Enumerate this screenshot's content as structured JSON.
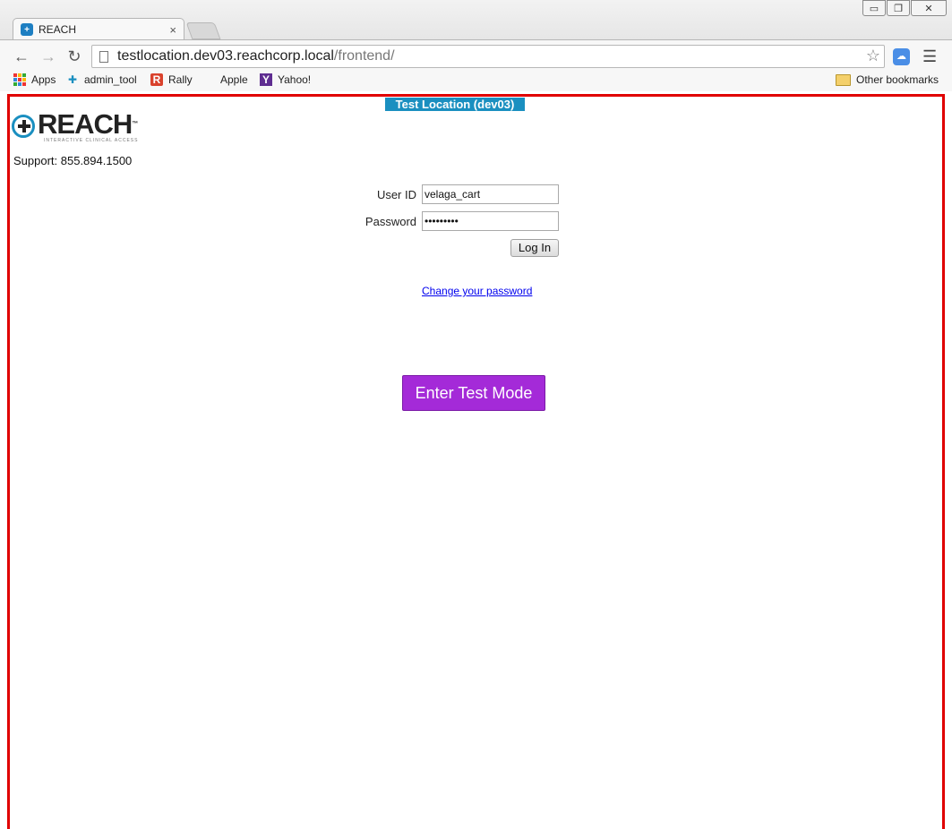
{
  "window": {
    "minimize_glyph": "▭",
    "restore_glyph": "❐",
    "close_glyph": "✕"
  },
  "tab": {
    "title": "REACH",
    "favicon": "+",
    "close_glyph": "×"
  },
  "toolbar": {
    "back_glyph": "←",
    "forward_glyph": "→",
    "reload_glyph": "↻",
    "url_host": "testlocation.dev03.reachcorp.local",
    "url_path": "/frontend/",
    "star_glyph": "☆",
    "menu_glyph": "☰",
    "extension_glyph": "☁"
  },
  "bookmarks": {
    "items": [
      {
        "label": "Apps",
        "icon": "apps-grid-icon"
      },
      {
        "label": "admin_tool",
        "icon": "puzzle-icon"
      },
      {
        "label": "Rally",
        "icon": "rally-icon"
      },
      {
        "label": "Apple",
        "icon": "apple-icon"
      },
      {
        "label": "Yahoo!",
        "icon": "yahoo-icon"
      }
    ],
    "other": "Other bookmarks",
    "glyphs": {
      "admin_tool": "✚",
      "rally": "R",
      "apple": "",
      "yahoo": "Y"
    }
  },
  "page": {
    "env_banner": "Test Location (dev03)",
    "logo_text": "REACH",
    "logo_tm": "™",
    "logo_tagline": "INTERACTIVE CLINICAL ACCESS",
    "support": "Support: 855.894.1500",
    "login": {
      "user_id_label": "User ID",
      "user_id_value": "velaga_cart",
      "password_label": "Password",
      "password_value": "•••••••••",
      "button": "Log In"
    },
    "change_password": "Change your password",
    "test_mode_button": "Enter Test Mode"
  },
  "colors": {
    "page_border": "#e00000",
    "banner_bg": "#1a8fc0",
    "test_button_bg": "#a42ad8",
    "link": "#0000ee"
  }
}
